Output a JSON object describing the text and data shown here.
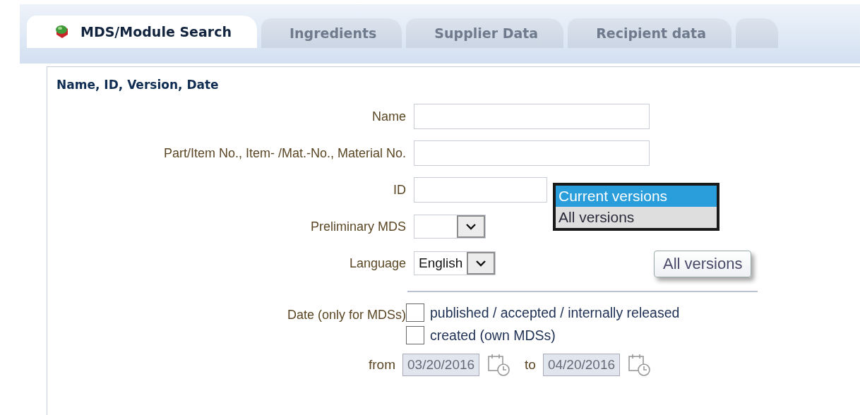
{
  "tabs": [
    {
      "label": "MDS/Module Search",
      "selected": true
    },
    {
      "label": "Ingredients",
      "selected": false
    },
    {
      "label": "Supplier Data",
      "selected": false
    },
    {
      "label": "Recipient data",
      "selected": false
    }
  ],
  "section": {
    "title": "Name, ID, Version, Date"
  },
  "fields": [
    {
      "kind": "text",
      "label": "Name"
    },
    {
      "kind": "text",
      "label": "Part/Item No., Item- /Mat.-No., Material No."
    },
    {
      "kind": "short",
      "label": "ID"
    },
    {
      "kind": "select",
      "label": "Preliminary MDS"
    },
    {
      "kind": "select",
      "label": "Language",
      "value": "English"
    }
  ],
  "version_list": {
    "options": [
      {
        "label": "Current versions",
        "selected": true
      },
      {
        "label": "All versions",
        "selected": false
      }
    ]
  },
  "tooltip": "All versions",
  "date": {
    "label": "Date (only for MDSs)",
    "checkboxes": [
      {
        "label": "published / accepted / internally released",
        "checked": false
      },
      {
        "label": "created (own MDSs)",
        "checked": false
      }
    ],
    "from_label": "from",
    "from_value": "03/20/2016",
    "to_label": "to",
    "to_value": "04/20/2016",
    "disabled": true
  }
}
